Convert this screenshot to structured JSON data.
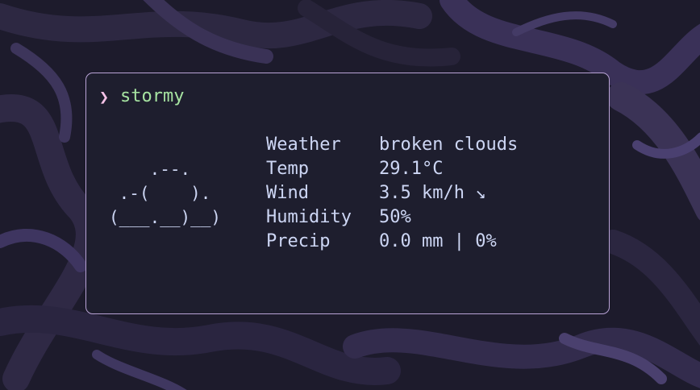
{
  "terminal": {
    "prompt_symbol": "❯",
    "command": "stormy",
    "ascii_art": [
      "    .--.",
      " .-(    ).",
      "(___.__)__)"
    ],
    "rows": [
      {
        "label": "Weather",
        "value": "broken clouds"
      },
      {
        "label": "Temp",
        "value": "29.1°C"
      },
      {
        "label": "Wind",
        "value": "3.5 km/h ↘"
      },
      {
        "label": "Humidity",
        "value": "50%"
      },
      {
        "label": "Precip",
        "value": "0.0 mm | 0%"
      }
    ]
  },
  "colors": {
    "window_background": "#1e1e2e",
    "window_border": "#b9a3d6",
    "prompt_symbol": "#f5c2e7",
    "command": "#a6e3a1",
    "text": "#cdd6f4"
  }
}
